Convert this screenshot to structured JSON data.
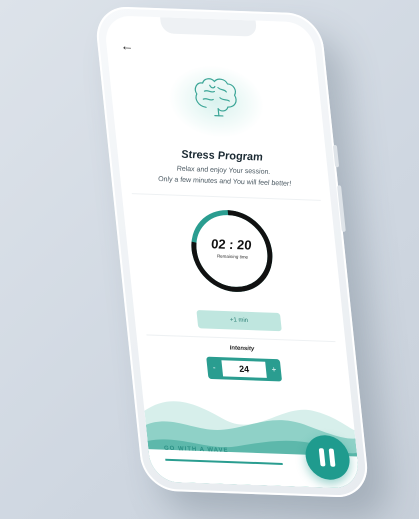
{
  "header": {
    "back_icon": "arrow-left-icon"
  },
  "program": {
    "icon": "brain-icon",
    "title": "Stress Program",
    "subtitle_line1": "Relax and enjoy Your session.",
    "subtitle_line2": "Only a few minutes and You will feel better!"
  },
  "timer": {
    "time": "02 : 20",
    "label": "Remaining time",
    "progress": 0.78
  },
  "add_time": {
    "label": "+1 min"
  },
  "intensity": {
    "label": "Intensity",
    "value": "24",
    "minus": "-",
    "plus": "+"
  },
  "footer": {
    "cta_label": "GO WITH A WAVE",
    "pause_icon": "pause-icon"
  },
  "colors": {
    "accent": "#2a9d90",
    "accent_light": "#bfe6df",
    "background": "#d4dbe3"
  }
}
